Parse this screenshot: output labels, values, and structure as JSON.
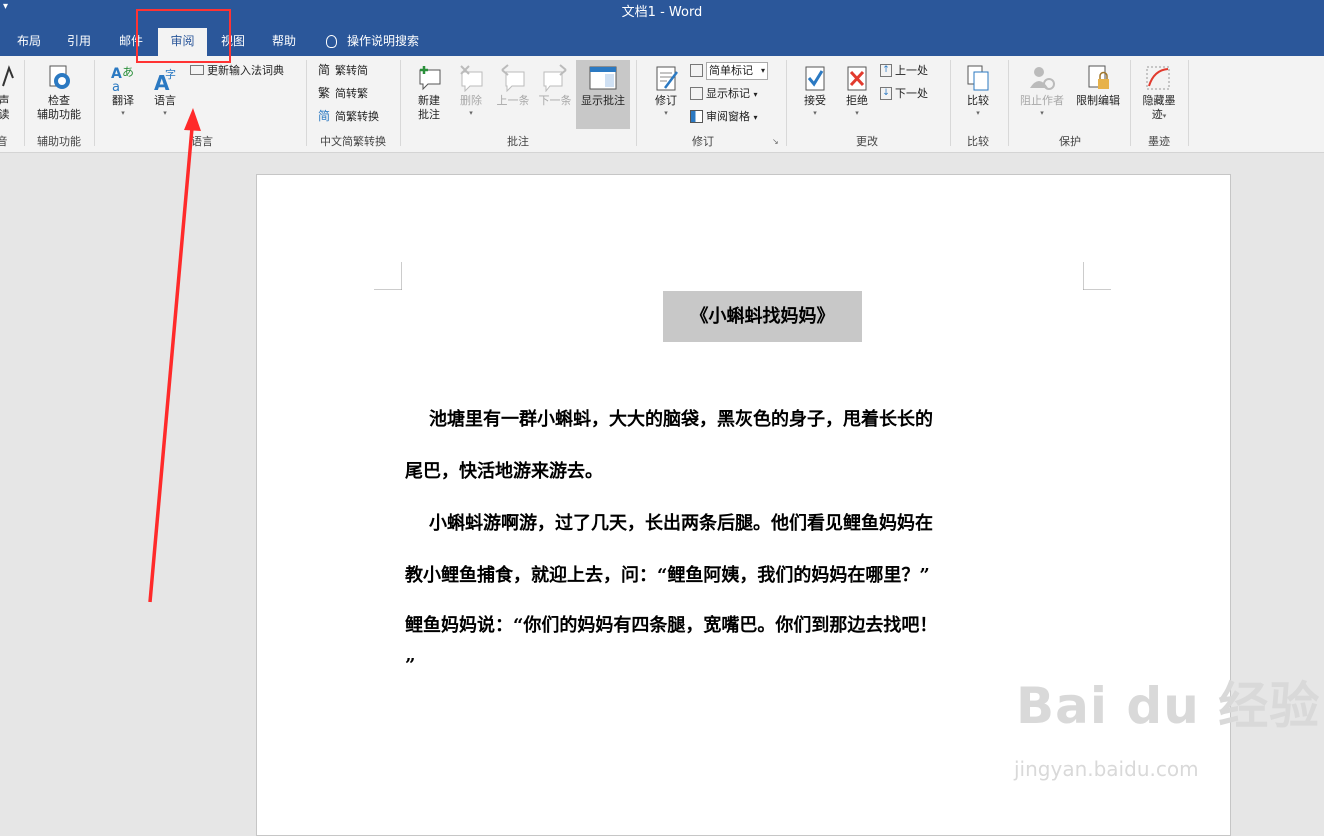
{
  "window": {
    "title": "文档1  -  Word",
    "qat_glyph": "▾"
  },
  "tabs": [
    {
      "label": "布局",
      "active": false
    },
    {
      "label": "引用",
      "active": false
    },
    {
      "label": "邮件",
      "active": false
    },
    {
      "label": "审阅",
      "active": true
    },
    {
      "label": "视图",
      "active": false
    },
    {
      "label": "帮助",
      "active": false
    }
  ],
  "tell_me": {
    "label": "操作说明搜索",
    "icon": "lightbulb-icon"
  },
  "ribbon": {
    "partial_left": {
      "btn_line1": "声",
      "btn_line2": "读",
      "group": "音"
    },
    "accessibility": {
      "btn_line1": "检查",
      "btn_line2": "辅助功能",
      "group": "辅助功能"
    },
    "language": {
      "translate": "翻译",
      "language": "语言",
      "update_ime": "更新输入法词典",
      "group": "语言"
    },
    "chinese": {
      "to_simplified": "繁转简",
      "to_traditional": "简转繁",
      "convert": "简繁转换",
      "group": "中文简繁转换"
    },
    "comments": {
      "new": "新建",
      "new2": "批注",
      "delete": "删除",
      "prev": "上一条",
      "next": "下一条",
      "show": "显示批注",
      "group": "批注"
    },
    "tracking": {
      "track": "修订",
      "markup_value": "简单标记",
      "show_markup": "显示标记",
      "pane": "审阅窗格",
      "group": "修订"
    },
    "changes": {
      "accept": "接受",
      "reject": "拒绝",
      "previous": "上一处",
      "next": "下一处",
      "group": "更改"
    },
    "compare": {
      "compare": "比较",
      "group": "比较"
    },
    "protect": {
      "block": "阻止作者",
      "restrict": "限制编辑",
      "group": "保护"
    },
    "ink": {
      "hide_line1": "隐藏墨",
      "hide_line2": "迹",
      "group": "墨迹"
    }
  },
  "document": {
    "title": "《小蝌蚪找妈妈》",
    "lines": [
      "池塘里有一群小蝌蚪，大大的脑袋，黑灰色的身子，甩着长长的",
      "尾巴，快活地游来游去。",
      "小蝌蚪游啊游，过了几天，长出两条后腿。他们看见鲤鱼妈妈在",
      "教小鲤鱼捕食，就迎上去，问：“鲤鱼阿姨，我们的妈妈在哪里？”",
      "鲤鱼妈妈说：“你们的妈妈有四条腿，宽嘴巴。你们到那边去找吧！",
      "”"
    ]
  },
  "watermark": {
    "brand": "Bai du 经验",
    "url": "jingyan.baidu.com"
  },
  "colors": {
    "title_bar": "#2b579a",
    "ribbon_bg": "#f3f3f3",
    "annotation_red": "#ff3333",
    "canvas_bg": "#e6e6e6"
  }
}
